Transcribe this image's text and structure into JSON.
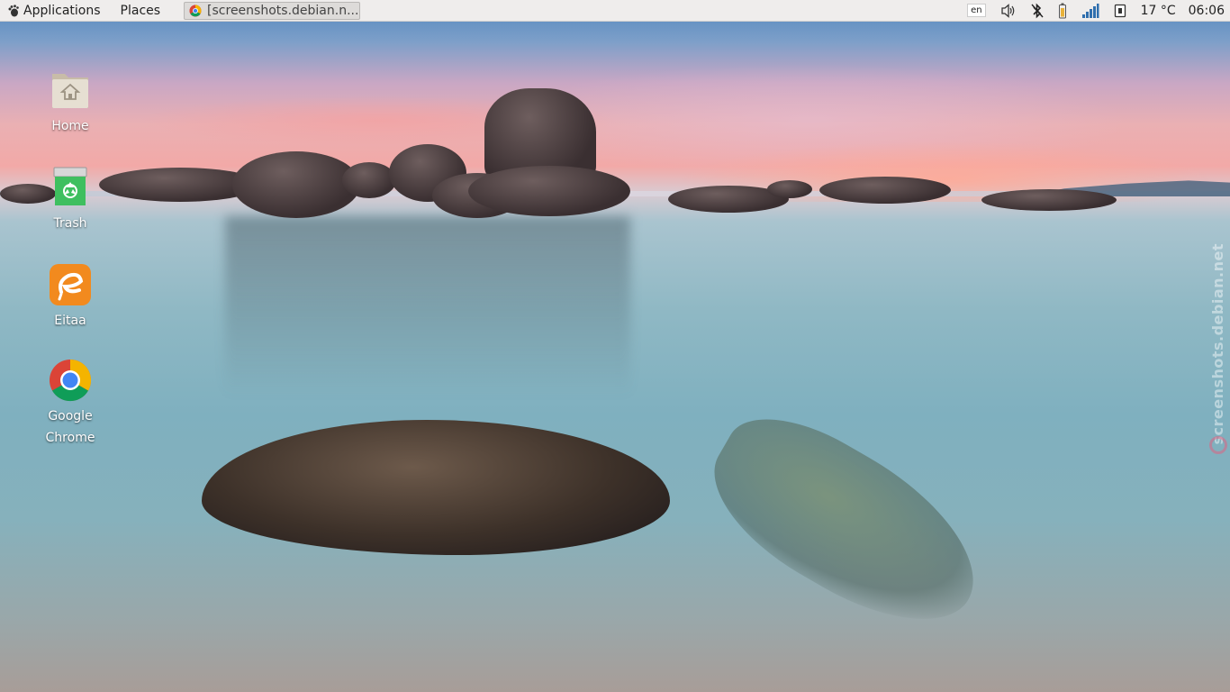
{
  "panel": {
    "applications_label": "Applications",
    "places_label": "Places",
    "task_title": "[screenshots.debian.n...",
    "lang": "en",
    "temperature": "17 °C",
    "time": "06:06"
  },
  "desktop_icons": [
    {
      "label": "Home",
      "icon": "home-folder-icon"
    },
    {
      "label": "Trash",
      "icon": "trash-icon"
    },
    {
      "label": "Eitaa",
      "icon": "eitaa-icon"
    },
    {
      "label": "Google Chrome",
      "icon": "chrome-icon"
    }
  ],
  "watermark": "screenshots.debian.net",
  "colors": {
    "panel_bg": "#efedec",
    "eitaa_orange": "#f28a1e",
    "trash_green": "#3fbf5f"
  }
}
